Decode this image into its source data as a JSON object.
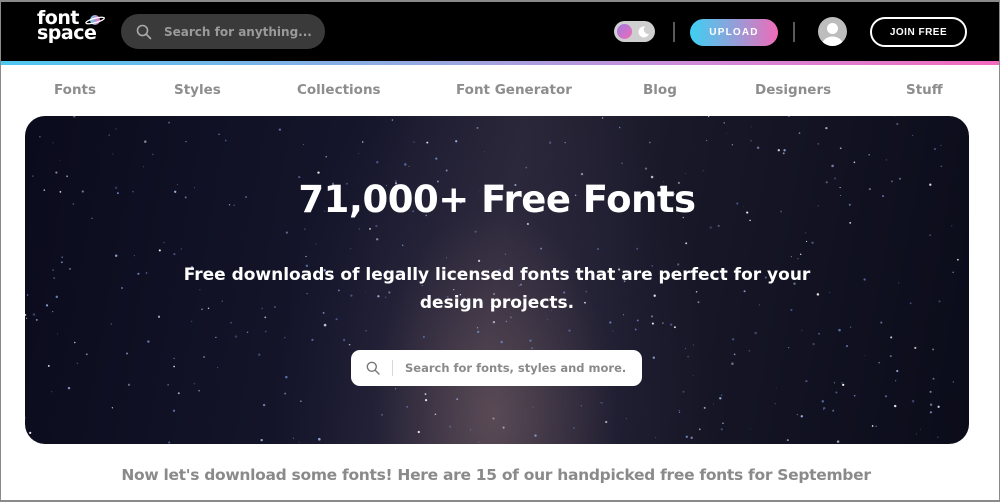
{
  "header": {
    "logo": {
      "line1": "font",
      "line2": "space"
    },
    "search_placeholder": "Search for anything...",
    "upload_label": "UPLOAD",
    "join_label": "JOIN FREE",
    "theme_toggle": "dark-mode-toggle"
  },
  "nav": {
    "items": [
      {
        "label": "Fonts"
      },
      {
        "label": "Styles"
      },
      {
        "label": "Collections"
      },
      {
        "label": "Font Generator"
      },
      {
        "label": "Blog"
      },
      {
        "label": "Designers"
      },
      {
        "label": "Stuff"
      }
    ]
  },
  "hero": {
    "title": "71,000+ Free Fonts",
    "subtitle": "Free downloads of legally licensed fonts that are perfect for your design projects.",
    "search_placeholder": "Search for fonts, styles and more."
  },
  "tagline": "Now let's download some fonts! Here are 15 of our handpicked free fonts for September",
  "colors": {
    "topbar": "#000000",
    "accent_gradient_start": "#4fc7ef",
    "accent_gradient_end": "#f26bbd",
    "nav_text": "#8d8d8d"
  }
}
